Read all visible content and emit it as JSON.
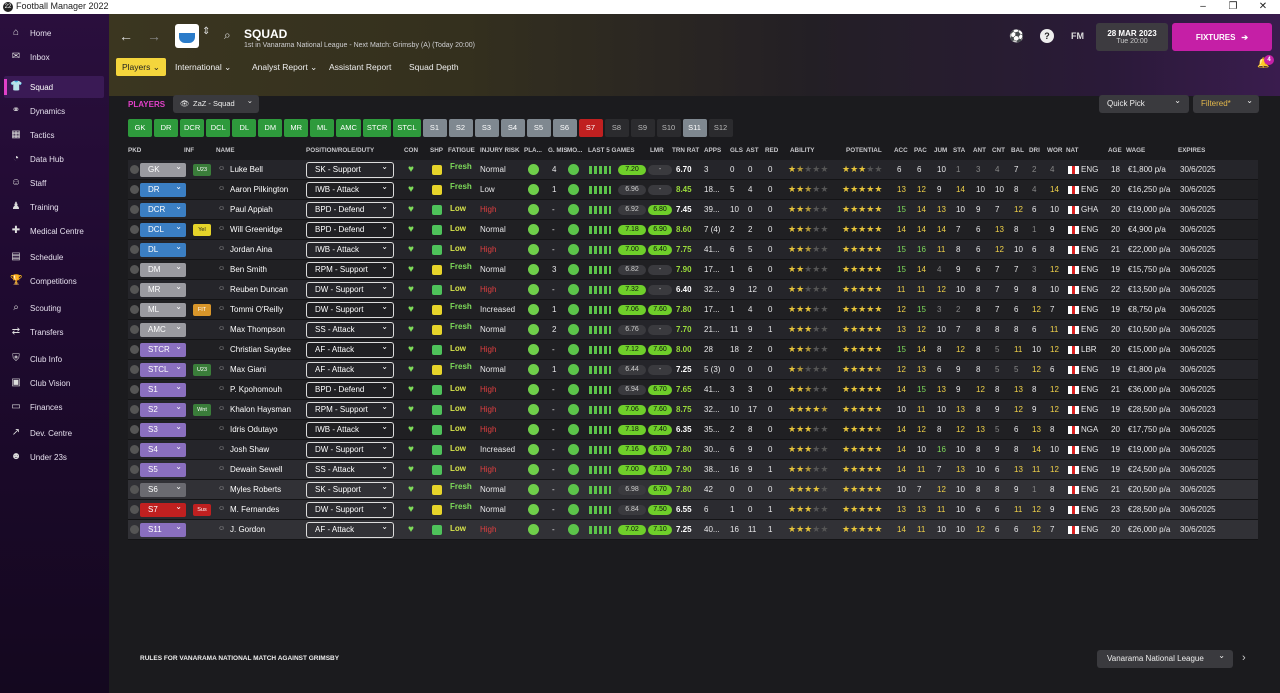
{
  "window": {
    "title": "Football Manager 2022",
    "minimize": "–",
    "maximize": "❐",
    "close": "✕"
  },
  "nav": [
    {
      "label": "Home",
      "icon": "⌂"
    },
    {
      "label": "Inbox",
      "icon": "✉"
    },
    {
      "label": "Squad",
      "icon": "👕"
    },
    {
      "label": "Dynamics",
      "icon": "⚭"
    },
    {
      "label": "Tactics",
      "icon": "▦"
    },
    {
      "label": "Data Hub",
      "icon": "◔"
    },
    {
      "label": "Staff",
      "icon": "☺"
    },
    {
      "label": "Training",
      "icon": "♟"
    },
    {
      "label": "Medical Centre",
      "icon": "✚"
    },
    {
      "label": "Schedule",
      "icon": "▤"
    },
    {
      "label": "Competitions",
      "icon": "🏆"
    },
    {
      "label": "Scouting",
      "icon": "⌕"
    },
    {
      "label": "Transfers",
      "icon": "⇄"
    },
    {
      "label": "Club Info",
      "icon": "⛨"
    },
    {
      "label": "Club Vision",
      "icon": "▣"
    },
    {
      "label": "Finances",
      "icon": "▭"
    },
    {
      "label": "Dev. Centre",
      "icon": "↗"
    },
    {
      "label": "Under 23s",
      "icon": "☻"
    }
  ],
  "header": {
    "title": "SQUAD",
    "subtitle": "1st in Vanarama National League - Next Match: Grimsby (A) (Today 20:00)",
    "date": "28 MAR 2023",
    "time": "Tue 20:00",
    "fixtures": "FIXTURES",
    "fm": "FM",
    "help": "?",
    "notifications": "4"
  },
  "tabs": [
    "Players",
    "International",
    "Analyst Report",
    "Assistant Report",
    "Squad Depth"
  ],
  "players_label": "PLAYERS",
  "view": "ZaZ - Squad",
  "quick_pick": "Quick Pick",
  "filtered": "Filtered*",
  "pos_filters": [
    {
      "l": "GK",
      "t": "g"
    },
    {
      "l": "DR",
      "t": "g"
    },
    {
      "l": "DCR",
      "t": "g"
    },
    {
      "l": "DCL",
      "t": "g"
    },
    {
      "l": "DL",
      "t": "g"
    },
    {
      "l": "DM",
      "t": "g"
    },
    {
      "l": "MR",
      "t": "g"
    },
    {
      "l": "ML",
      "t": "g"
    },
    {
      "l": "AMC",
      "t": "g"
    },
    {
      "l": "STCR",
      "t": "g"
    },
    {
      "l": "STCL",
      "t": "g"
    },
    {
      "l": "S1",
      "t": "s"
    },
    {
      "l": "S2",
      "t": "s"
    },
    {
      "l": "S3",
      "t": "s"
    },
    {
      "l": "S4",
      "t": "s"
    },
    {
      "l": "S5",
      "t": "s"
    },
    {
      "l": "S6",
      "t": "s"
    },
    {
      "l": "S7",
      "t": "r"
    },
    {
      "l": "S8",
      "t": "n"
    },
    {
      "l": "S9",
      "t": "n"
    },
    {
      "l": "S10",
      "t": "n"
    },
    {
      "l": "S11",
      "t": "s"
    },
    {
      "l": "S12",
      "t": "n"
    }
  ],
  "columns": [
    "PKD",
    "INF",
    "NAME",
    "POSITION/ROLE/DUTY",
    "CON",
    "SHP",
    "FATIGUE",
    "INJURY RISK",
    "PLA...",
    "G. MIS",
    "MO...",
    "LAST 5 GAMES",
    "LMR",
    "TRN RAT",
    "APPS",
    "GLS",
    "AST",
    "RED",
    "ABILITY",
    "POTENTIAL",
    "ACC",
    "PAC",
    "JUM",
    "STA",
    "ANT",
    "CNT",
    "BAL",
    "DRI",
    "WOR",
    "NAT",
    "AGE",
    "WAGE",
    "EXPIRES"
  ],
  "players": [
    {
      "pos": "GK",
      "pc": "#9a9aa0",
      "inf": "U23",
      "ic": "#3a7d3a",
      "name": "Luke Bell",
      "role": "SK - Support",
      "fat": "Fresh",
      "risk": "Normal",
      "gmis": "4",
      "lmr": "7.20",
      "lmr2": "-",
      "trn": "6.70",
      "apps": "3",
      "gls": "0",
      "ast": "0",
      "red": "0",
      "abl": 1.5,
      "pot": 3,
      "attrs": [
        "6",
        "6",
        "10",
        "1",
        "3",
        "4",
        "7",
        "2",
        "4"
      ],
      "nat": "ENG",
      "age": "18",
      "wage": "€1,800 p/a",
      "exp": "30/6/2025"
    },
    {
      "pos": "DR",
      "pc": "#3b7fc4",
      "inf": "",
      "ic": "",
      "name": "Aaron Pilkington",
      "role": "IWB - Attack",
      "fat": "Fresh",
      "risk": "Low",
      "gmis": "1",
      "lmr": "6.96",
      "lmr2": "-",
      "trn": "8.45",
      "apps": "18...",
      "gls": "5",
      "ast": "4",
      "red": "0",
      "abl": 2.5,
      "pot": 5,
      "attrs": [
        "13",
        "12",
        "9",
        "14",
        "10",
        "10",
        "8",
        "4",
        "14"
      ],
      "nat": "ENG",
      "age": "20",
      "wage": "€16,250 p/a",
      "exp": "30/6/2025"
    },
    {
      "pos": "DCR",
      "pc": "#3b7fc4",
      "inf": "",
      "ic": "",
      "name": "Paul Appiah",
      "role": "BPD - Defend",
      "fat": "Low",
      "risk": "High",
      "gmis": "-",
      "lmr": "6.92",
      "lmr2": "6.80",
      "trn": "7.45",
      "apps": "39...",
      "gls": "10",
      "ast": "0",
      "red": "0",
      "abl": 2.5,
      "pot": 5,
      "attrs": [
        "15",
        "14",
        "13",
        "10",
        "9",
        "7",
        "12",
        "6",
        "10"
      ],
      "nat": "GHA",
      "age": "20",
      "wage": "€19,000 p/a",
      "exp": "30/6/2025"
    },
    {
      "pos": "DCL",
      "pc": "#3b7fc4",
      "inf": "Yel",
      "ic": "#e6d42a",
      "name": "Will Greenidge",
      "role": "BPD - Defend",
      "fat": "Low",
      "risk": "Normal",
      "gmis": "-",
      "lmr": "7.18",
      "lmr2": "6.90",
      "trn": "8.60",
      "apps": "7 (4)",
      "gls": "2",
      "ast": "2",
      "red": "0",
      "abl": 2.5,
      "pot": 5,
      "attrs": [
        "14",
        "14",
        "14",
        "7",
        "6",
        "13",
        "8",
        "1",
        "9"
      ],
      "nat": "ENG",
      "age": "20",
      "wage": "€4,900 p/a",
      "exp": "30/6/2025"
    },
    {
      "pos": "DL",
      "pc": "#3b7fc4",
      "inf": "",
      "ic": "",
      "name": "Jordan Aina",
      "role": "IWB - Attack",
      "fat": "Low",
      "risk": "High",
      "gmis": "-",
      "lmr": "7.00",
      "lmr2": "6.40",
      "trn": "7.75",
      "apps": "41...",
      "gls": "6",
      "ast": "5",
      "red": "0",
      "abl": 2.5,
      "pot": 5,
      "attrs": [
        "15",
        "16",
        "11",
        "8",
        "6",
        "12",
        "10",
        "6",
        "8"
      ],
      "nat": "ENG",
      "age": "21",
      "wage": "€22,000 p/a",
      "exp": "30/6/2025"
    },
    {
      "pos": "DM",
      "pc": "#9a9aa0",
      "inf": "",
      "ic": "",
      "name": "Ben Smith",
      "role": "RPM - Support",
      "fat": "Fresh",
      "risk": "Normal",
      "gmis": "3",
      "lmr": "6.82",
      "lmr2": "-",
      "trn": "7.90",
      "apps": "17...",
      "gls": "1",
      "ast": "6",
      "red": "0",
      "abl": 2,
      "pot": 5,
      "attrs": [
        "15",
        "14",
        "4",
        "9",
        "6",
        "7",
        "7",
        "3",
        "12"
      ],
      "nat": "ENG",
      "age": "19",
      "wage": "€15,750 p/a",
      "exp": "30/6/2025"
    },
    {
      "pos": "MR",
      "pc": "#9a9aa0",
      "inf": "",
      "ic": "",
      "name": "Reuben Duncan",
      "role": "DW - Support",
      "fat": "Low",
      "risk": "High",
      "gmis": "-",
      "lmr": "7.32",
      "lmr2": "-",
      "trn": "6.40",
      "apps": "32...",
      "gls": "9",
      "ast": "12",
      "red": "0",
      "abl": 2,
      "pot": 5,
      "attrs": [
        "11",
        "11",
        "12",
        "10",
        "8",
        "7",
        "9",
        "8",
        "10"
      ],
      "nat": "ENG",
      "age": "22",
      "wage": "€13,500 p/a",
      "exp": "30/6/2025"
    },
    {
      "pos": "ML",
      "pc": "#9a9aa0",
      "inf": "FIT",
      "ic": "#d9962a",
      "name": "Tommi O'Reilly",
      "role": "DW - Support",
      "fat": "Fresh",
      "risk": "Increased",
      "gmis": "1",
      "lmr": "7.06",
      "lmr2": "7.60",
      "trn": "7.80",
      "apps": "17...",
      "gls": "1",
      "ast": "4",
      "red": "0",
      "abl": 3,
      "pot": 5,
      "attrs": [
        "12",
        "15",
        "3",
        "2",
        "8",
        "7",
        "6",
        "12",
        "7"
      ],
      "nat": "ENG",
      "age": "19",
      "wage": "€8,750 p/a",
      "exp": "30/6/2025"
    },
    {
      "pos": "AMC",
      "pc": "#9a9aa0",
      "inf": "",
      "ic": "",
      "name": "Max Thompson",
      "role": "SS - Attack",
      "fat": "Fresh",
      "risk": "Normal",
      "gmis": "2",
      "lmr": "6.76",
      "lmr2": "-",
      "trn": "7.70",
      "apps": "21...",
      "gls": "11",
      "ast": "9",
      "red": "1",
      "abl": 3,
      "pot": 5,
      "attrs": [
        "13",
        "12",
        "10",
        "7",
        "8",
        "8",
        "8",
        "6",
        "11"
      ],
      "nat": "ENG",
      "age": "20",
      "wage": "€10,500 p/a",
      "exp": "30/6/2025"
    },
    {
      "pos": "STCR",
      "pc": "#8a6fbf",
      "inf": "",
      "ic": "",
      "name": "Christian Saydee",
      "role": "AF - Attack",
      "fat": "Low",
      "risk": "High",
      "gmis": "-",
      "lmr": "7.12",
      "lmr2": "7.60",
      "trn": "8.00",
      "apps": "28",
      "gls": "18",
      "ast": "2",
      "red": "0",
      "abl": 2.5,
      "pot": 5,
      "attrs": [
        "15",
        "14",
        "8",
        "12",
        "8",
        "5",
        "11",
        "10",
        "12"
      ],
      "nat": "LBR",
      "age": "20",
      "wage": "€15,000 p/a",
      "exp": "30/6/2025"
    },
    {
      "pos": "STCL",
      "pc": "#8a6fbf",
      "inf": "U23",
      "ic": "#3a7d3a",
      "name": "Max Giani",
      "role": "AF - Attack",
      "fat": "Fresh",
      "risk": "Normal",
      "gmis": "1",
      "lmr": "6.44",
      "lmr2": "-",
      "trn": "7.25",
      "apps": "5 (3)",
      "gls": "0",
      "ast": "0",
      "red": "0",
      "abl": 1.5,
      "pot": 4.5,
      "attrs": [
        "12",
        "13",
        "6",
        "9",
        "8",
        "5",
        "5",
        "12",
        "6"
      ],
      "nat": "ENG",
      "age": "19",
      "wage": "€1,800 p/a",
      "exp": "30/6/2025"
    },
    {
      "pos": "S1",
      "pc": "#8a6fbf",
      "inf": "",
      "ic": "",
      "name": "P. Kpohomouh",
      "role": "BPD - Defend",
      "fat": "Low",
      "risk": "High",
      "gmis": "-",
      "lmr": "6.94",
      "lmr2": "6.70",
      "trn": "7.65",
      "apps": "41...",
      "gls": "3",
      "ast": "3",
      "red": "0",
      "abl": 2.5,
      "pot": 5,
      "attrs": [
        "14",
        "15",
        "13",
        "9",
        "12",
        "8",
        "13",
        "8",
        "12"
      ],
      "nat": "ENG",
      "age": "21",
      "wage": "€36,000 p/a",
      "exp": "30/6/2025"
    },
    {
      "pos": "S2",
      "pc": "#8a6fbf",
      "inf": "Wnt",
      "ic": "#3a7d3a",
      "name": "Khalon Haysman",
      "role": "RPM - Support",
      "fat": "Low",
      "risk": "High",
      "gmis": "-",
      "lmr": "7.06",
      "lmr2": "7.60",
      "trn": "8.75",
      "apps": "32...",
      "gls": "10",
      "ast": "17",
      "red": "0",
      "abl": 4.5,
      "pot": 5,
      "attrs": [
        "10",
        "11",
        "10",
        "13",
        "8",
        "9",
        "12",
        "9",
        "12"
      ],
      "nat": "ENG",
      "age": "19",
      "wage": "€28,500 p/a",
      "exp": "30/6/2023"
    },
    {
      "pos": "S3",
      "pc": "#8a6fbf",
      "inf": "",
      "ic": "",
      "name": "Idris Odutayo",
      "role": "IWB - Attack",
      "fat": "Low",
      "risk": "High",
      "gmis": "-",
      "lmr": "7.18",
      "lmr2": "7.40",
      "trn": "6.35",
      "apps": "35...",
      "gls": "2",
      "ast": "8",
      "red": "0",
      "abl": 3,
      "pot": 4.5,
      "attrs": [
        "14",
        "12",
        "8",
        "12",
        "13",
        "5",
        "6",
        "13",
        "8"
      ],
      "nat": "NGA",
      "age": "20",
      "wage": "€17,750 p/a",
      "exp": "30/6/2025"
    },
    {
      "pos": "S4",
      "pc": "#8a6fbf",
      "inf": "",
      "ic": "",
      "name": "Josh Shaw",
      "role": "DW - Support",
      "fat": "Low",
      "risk": "Increased",
      "gmis": "-",
      "lmr": "7.16",
      "lmr2": "6.70",
      "trn": "7.80",
      "apps": "30...",
      "gls": "6",
      "ast": "9",
      "red": "0",
      "abl": 3,
      "pot": 5,
      "attrs": [
        "14",
        "10",
        "16",
        "10",
        "8",
        "9",
        "8",
        "14",
        "10"
      ],
      "nat": "ENG",
      "age": "19",
      "wage": "€19,000 p/a",
      "exp": "30/6/2025"
    },
    {
      "pos": "S5",
      "pc": "#8a6fbf",
      "inf": "",
      "ic": "",
      "name": "Dewain Sewell",
      "role": "SS - Attack",
      "fat": "Low",
      "risk": "High",
      "gmis": "-",
      "lmr": "7.00",
      "lmr2": "7.10",
      "trn": "7.90",
      "apps": "38...",
      "gls": "16",
      "ast": "9",
      "red": "1",
      "abl": 2.5,
      "pot": 5,
      "attrs": [
        "14",
        "11",
        "7",
        "13",
        "10",
        "6",
        "13",
        "11",
        "12"
      ],
      "nat": "ENG",
      "age": "19",
      "wage": "€24,500 p/a",
      "exp": "30/6/2025"
    },
    {
      "pos": "S6",
      "pc": "#6a6a70",
      "inf": "",
      "ic": "",
      "name": "Myles Roberts",
      "role": "SK - Support",
      "fat": "Fresh",
      "risk": "Normal",
      "gmis": "-",
      "lmr": "6.98",
      "lmr2": "6.70",
      "trn": "7.80",
      "apps": "42",
      "gls": "0",
      "ast": "0",
      "red": "0",
      "abl": 4,
      "pot": 5,
      "attrs": [
        "10",
        "7",
        "12",
        "10",
        "8",
        "8",
        "9",
        "1",
        "8"
      ],
      "nat": "ENG",
      "age": "21",
      "wage": "€20,500 p/a",
      "exp": "30/6/2025"
    },
    {
      "pos": "S7",
      "pc": "#c02020",
      "inf": "Sus",
      "ic": "#c02020",
      "name": "M. Fernandes",
      "role": "DW - Support",
      "fat": "Fresh",
      "risk": "Normal",
      "gmis": "-",
      "lmr": "6.84",
      "lmr2": "7.50",
      "trn": "6.55",
      "apps": "6",
      "gls": "1",
      "ast": "0",
      "red": "1",
      "abl": 3,
      "pot": 5,
      "attrs": [
        "13",
        "13",
        "11",
        "10",
        "6",
        "6",
        "11",
        "12",
        "9"
      ],
      "nat": "ENG",
      "age": "23",
      "wage": "€28,500 p/a",
      "exp": "30/6/2025"
    },
    {
      "pos": "S11",
      "pc": "#8a6fbf",
      "inf": "",
      "ic": "",
      "name": "J. Gordon",
      "role": "AF - Attack",
      "fat": "Low",
      "risk": "High",
      "gmis": "-",
      "lmr": "7.02",
      "lmr2": "7.10",
      "trn": "7.25",
      "apps": "40...",
      "gls": "16",
      "ast": "11",
      "red": "1",
      "abl": 3,
      "pot": 5,
      "attrs": [
        "14",
        "11",
        "10",
        "10",
        "12",
        "6",
        "6",
        "12",
        "7"
      ],
      "nat": "ENG",
      "age": "20",
      "wage": "€26,000 p/a",
      "exp": "30/6/2025"
    }
  ],
  "footer": {
    "rules": "RULES FOR VANARAMA NATIONAL MATCH AGAINST GRIMSBY",
    "league": "Vanarama National League"
  }
}
